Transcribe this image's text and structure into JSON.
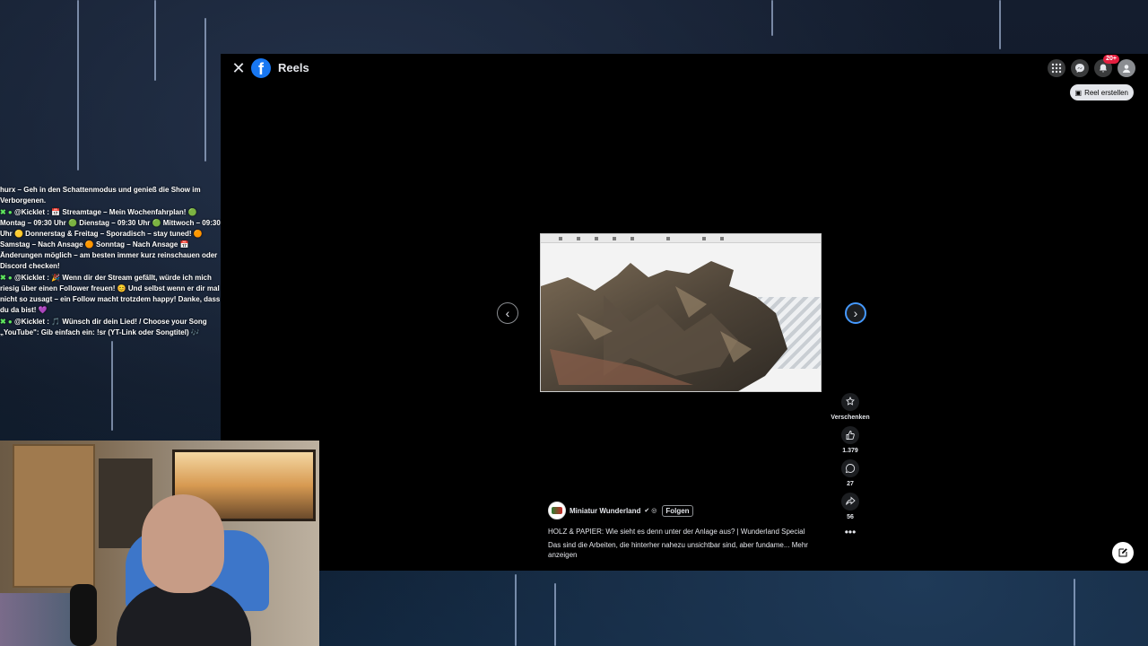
{
  "facebook": {
    "page_title": "Reels",
    "logo_letter": "f",
    "close_symbol": "✕",
    "notification_badge": "20+",
    "create_reel_label": "Reel erstellen",
    "icons": [
      "grid-menu-icon",
      "messenger-icon",
      "bell-icon",
      "account-icon"
    ]
  },
  "reel": {
    "nav_prev_symbol": "‹",
    "nav_next_symbol": "›",
    "author": "Miniatur Wunderland",
    "follow_label": "Folgen",
    "caption_title": "HOLZ & PAPIER: Wie sieht es denn unter der Anlage aus? | Wunderland Special",
    "caption_text": "Das sind die Arbeiten, die hinterher nahezu unsichtbar sind, aber fundame... Mehr anzeigen",
    "actions": {
      "gift_label": "Verschenken",
      "likes": "1.379",
      "comments": "27",
      "shares": "56",
      "more_symbol": "•••"
    }
  },
  "chat": {
    "lines": [
      "hurx – Geh in den Schattenmodus und genieß die Show im Verborgenen.",
      "@Kicklet : 📅 Streamtage – Mein Wochenfahrplan! 🟢 Montag – 09:30 Uhr 🟢 Dienstag – 09:30 Uhr 🟢 Mittwoch – 09:30 Uhr 🟡 Donnerstag & Freitag – Sporadisch – stay tuned! 🟠 Samstag – Nach Ansage 🟠 Sonntag – Nach Ansage 📅 Änderungen möglich – am besten immer kurz reinschauen oder Discord checken!",
      "@Kicklet : 🎉 Wenn dir der Stream gefällt, würde ich mich riesig über einen Follower freuen! 😊 Und selbst wenn er dir mal nicht so zusagt – ein Follow macht trotzdem happy! Danke, dass du da bist! 💜",
      "@Kicklet : 🎵 Wünsch dir dein Lied! / Choose your Song „YouTube\": Gib einfach ein: !sr (YT-Link oder Songtitel) 🎶"
    ]
  }
}
